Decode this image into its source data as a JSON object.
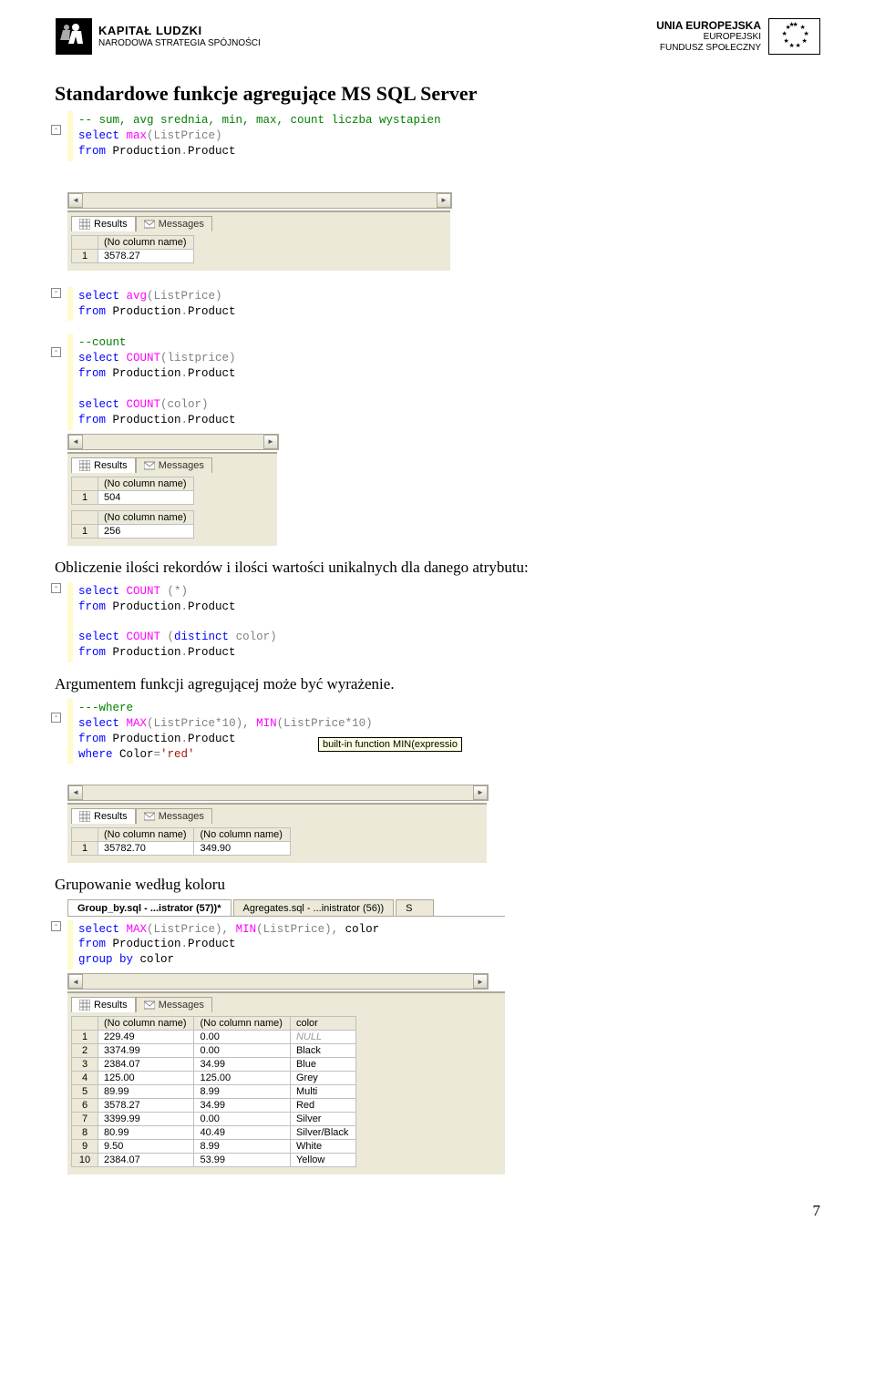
{
  "header": {
    "left_title": "KAPITAŁ LUDZKI",
    "left_sub": "NARODOWA STRATEGIA SPÓJNOŚCI",
    "right_line1": "UNIA EUROPEJSKA",
    "right_line2": "EUROPEJSKI",
    "right_line3": "FUNDUSZ SPOŁECZNY"
  },
  "title": "Standardowe funkcje agregujące MS SQL Server",
  "code1": {
    "comment": "-- sum, avg srednia, min, max, count liczba wystapien",
    "l1a": "select",
    "l1b": " max",
    "l1c": "(ListPrice)",
    "l2a": "from",
    "l2b": " Production",
    "l2c": ".",
    "l2d": "Product"
  },
  "tabs": {
    "results": "Results",
    "messages": "Messages"
  },
  "grid1": {
    "col": "(No column name)",
    "row": "1",
    "val": "3578.27"
  },
  "code2": {
    "l1a": "select",
    "l1b": " avg",
    "l1c": "(ListPrice)",
    "l2a": "from",
    "l2b": " Production",
    "l2c": ".",
    "l2d": "Product"
  },
  "code3": {
    "c1": "--count",
    "l1a": "select",
    "l1b": " COUNT",
    "l1c": "(listprice)",
    "l2a": "from",
    "l2b": " Production",
    "l2c": ".",
    "l2d": "Product",
    "l3a": "select",
    "l3b": " COUNT",
    "l3c": "(color)",
    "l4a": "from",
    "l4b": " Production",
    "l4c": ".",
    "l4d": "Product"
  },
  "grid3a": {
    "col": "(No column name)",
    "row": "1",
    "val": "504"
  },
  "grid3b": {
    "col": "(No column name)",
    "row": "1",
    "val": "256"
  },
  "para1": "Obliczenie ilości rekordów i ilości wartości unikalnych dla danego atrybutu:",
  "code4": {
    "l1a": "select",
    "l1b": " COUNT",
    "l1c": " (*)",
    "l2a": "from",
    "l2b": " Production",
    "l2c": ".",
    "l2d": "Product",
    "l3a": "select",
    "l3b": " COUNT",
    "l3c": " (",
    "l3d": "distinct",
    "l3e": " color)",
    "l4a": "from",
    "l4b": " Production",
    "l4c": ".",
    "l4d": "Product"
  },
  "para2": "Argumentem funkcji agregującej może być wyrażenie.",
  "code5": {
    "c1": "---where",
    "l1a": "select",
    "l1b": " MAX",
    "l1c": "(ListPrice",
    "l1d": "*",
    "l1e": "10)",
    "l1f": ",",
    "l1g": " MIN",
    "l1h": "(ListPrice",
    "l1i": "*",
    "l1j": "10)",
    "l2a": "from",
    "l2b": " Production",
    "l2c": ".",
    "l2d": "Product",
    "l3a": "where",
    "l3b": " Color",
    "l3c": "=",
    "l3d": "'red'"
  },
  "tooltip5": "built-in function MIN(expressio",
  "grid5": {
    "col1": "(No column name)",
    "col2": "(No column name)",
    "row": "1",
    "v1": "35782.70",
    "v2": "349.90"
  },
  "para3": "Grupowanie według koloru",
  "doctabs": {
    "t1": "Group_by.sql - ...istrator (57))*",
    "t2": "Agregates.sql - ...inistrator (56))",
    "t3": "S"
  },
  "code6": {
    "l1a": "select",
    "l1b": " MAX",
    "l1c": "(ListPrice)",
    "l1d": ",",
    "l1e": " MIN",
    "l1f": "(ListPrice)",
    "l1g": ",",
    "l1h": " color",
    "l2a": "from",
    "l2b": " Production",
    "l2c": ".",
    "l2d": "Product",
    "l3a": "group",
    "l3b": " by",
    "l3c": " color"
  },
  "grid6": {
    "cols": [
      "(No column name)",
      "(No column name)",
      "color"
    ],
    "rows": [
      {
        "n": "1",
        "a": "229.49",
        "b": "0.00",
        "c": "NULL"
      },
      {
        "n": "2",
        "a": "3374.99",
        "b": "0.00",
        "c": "Black"
      },
      {
        "n": "3",
        "a": "2384.07",
        "b": "34.99",
        "c": "Blue"
      },
      {
        "n": "4",
        "a": "125.00",
        "b": "125.00",
        "c": "Grey"
      },
      {
        "n": "5",
        "a": "89.99",
        "b": "8.99",
        "c": "Multi"
      },
      {
        "n": "6",
        "a": "3578.27",
        "b": "34.99",
        "c": "Red"
      },
      {
        "n": "7",
        "a": "3399.99",
        "b": "0.00",
        "c": "Silver"
      },
      {
        "n": "8",
        "a": "80.99",
        "b": "40.49",
        "c": "Silver/Black"
      },
      {
        "n": "9",
        "a": "9.50",
        "b": "8.99",
        "c": "White"
      },
      {
        "n": "10",
        "a": "2384.07",
        "b": "53.99",
        "c": "Yellow"
      }
    ]
  },
  "page_number": "7"
}
